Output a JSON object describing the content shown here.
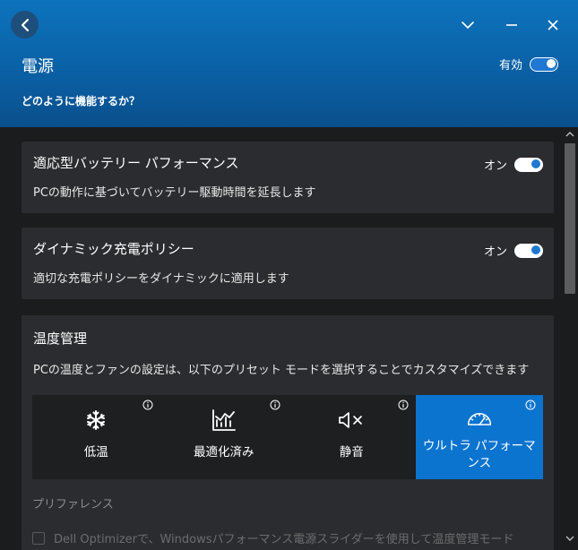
{
  "header": {
    "title": "電源",
    "subtitle": "どのように機能するか？",
    "enabled_label": "有効",
    "enabled": true
  },
  "cards": {
    "adaptive_battery": {
      "title": "適応型バッテリー パフォーマンス",
      "description": "PCの動作に基づいてバッテリー駆動時間を延長します",
      "toggle_label": "オン",
      "on": true
    },
    "dynamic_charging": {
      "title": "ダイナミック充電ポリシー",
      "description": "適切な充電ポリシーをダイナミックに適用します",
      "toggle_label": "オン",
      "on": true
    },
    "thermal": {
      "title": "温度管理",
      "description": "PCの温度とファンの設定は、以下のプリセット モードを選択することでカスタマイズできます",
      "presets": [
        {
          "label": "低温",
          "icon": "snowflake-icon",
          "selected": false
        },
        {
          "label": "最適化済み",
          "icon": "chart-icon",
          "selected": false
        },
        {
          "label": "静音",
          "icon": "speaker-mute-icon",
          "selected": false
        },
        {
          "label": "ウルトラ パフォーマンス",
          "icon": "speedometer-icon",
          "selected": true
        }
      ],
      "preference_label": "プリファレンス",
      "optimizer_text": "Dell Optimizerで、Windowsパフォーマンス電源スライダーを使用して温度管理モード"
    }
  },
  "colors": {
    "header_blue": "#0a5fa3",
    "accent_blue": "#0b74cf",
    "card_bg": "#2b2c2f",
    "page_bg": "#1b1c1e"
  }
}
